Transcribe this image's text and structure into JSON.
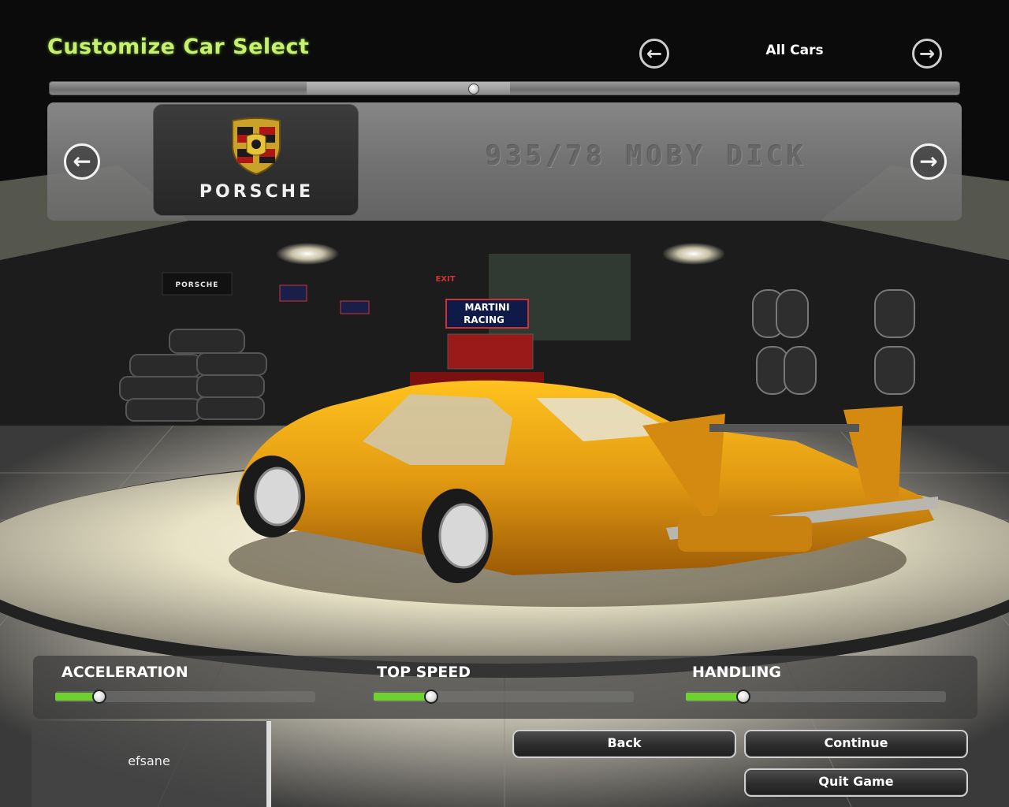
{
  "header": {
    "title": "Customize Car Select",
    "filter": {
      "label": "All Cars",
      "prev_icon": "arrow-left-icon",
      "next_icon": "arrow-right-icon"
    }
  },
  "car": {
    "brand": "PORSCHE",
    "model": "935/78 MOBY DICK",
    "car_color": "#e8a214",
    "prev_icon": "arrow-left-icon",
    "next_icon": "arrow-right-icon"
  },
  "garage": {
    "sign_brand": "PORSCHE",
    "sign_martini_1": "MARTINI",
    "sign_martini_2": "RACING",
    "exit_sign": "EXIT"
  },
  "stats": [
    {
      "label": "ACCELERATION",
      "value": 0.17
    },
    {
      "label": "TOP SPEED",
      "value": 0.22
    },
    {
      "label": "HANDLING",
      "value": 0.22
    }
  ],
  "footer": {
    "profile_name": "efsane",
    "back_label": "Back",
    "continue_label": "Continue",
    "quit_label": "Quit Game"
  },
  "colors": {
    "title_green": "#c8f070",
    "stat_fill": "#6fd12e"
  }
}
